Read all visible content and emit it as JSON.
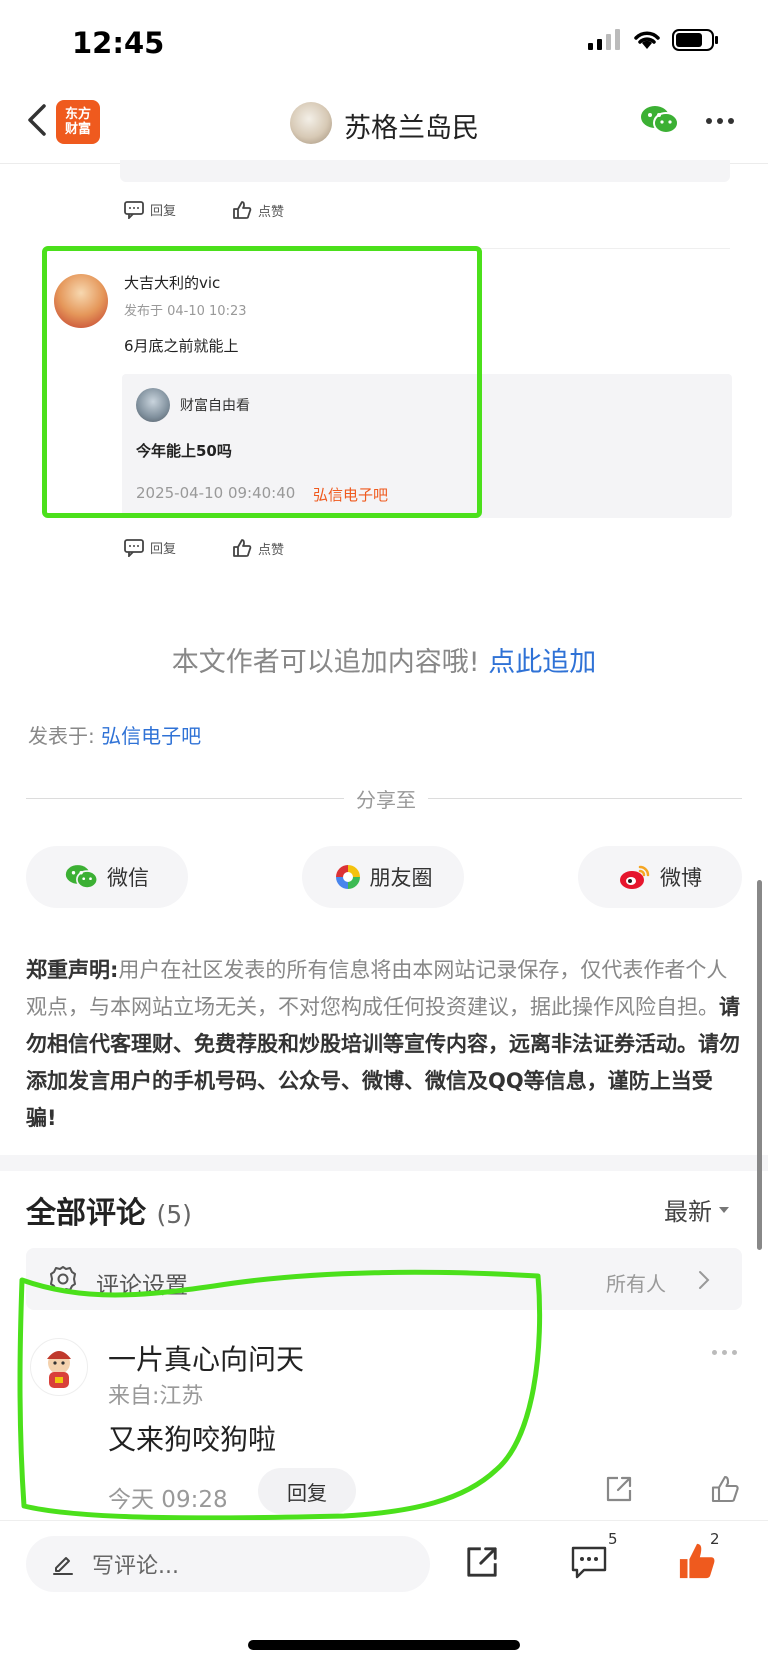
{
  "status_bar": {
    "time": "12:45"
  },
  "nav": {
    "logo_line1": "东方",
    "logo_line2": "财富",
    "title": "苏格兰岛民"
  },
  "top_actions": {
    "reply_label": "回复",
    "like_label": "点赞"
  },
  "reply": {
    "author": "大吉大利的vic",
    "posted_at": "发布于 04-10 10:23",
    "text": "6月底之前就能上",
    "quote": {
      "author": "财富自由看",
      "text": "今年能上50吗",
      "date": "2025-04-10 09:40:40",
      "bar": "弘信电子吧"
    },
    "reply_label": "回复",
    "like_label": "点赞"
  },
  "append": {
    "prompt": "本文作者可以追加内容哦!",
    "link": "点此追加"
  },
  "posted_in": {
    "label": "发表于:",
    "bar": "弘信电子吧"
  },
  "share": {
    "label": "分享至",
    "wechat": "微信",
    "moments": "朋友圈",
    "weibo": "微博"
  },
  "disclaimer": {
    "heading": "郑重声明:",
    "normal_text": "用户在社区发表的所有信息将由本网站记录保存，仅代表作者个人观点，与本网站立场无关，不对您构成任何投资建议，据此操作风险自担。",
    "bold_text": "请勿相信代客理财、免费荐股和炒股培训等宣传内容，远离非法证券活动。请勿添加发言用户的手机号码、公众号、微博、微信及QQ等信息，谨防上当受骗!"
  },
  "comments": {
    "title": "全部评论",
    "count": "(5)",
    "sort": "最新",
    "settings_label": "评论设置",
    "settings_value": "所有人",
    "items": [
      {
        "author": "一片真心向问天",
        "location": "来自:江苏",
        "text": "又来狗咬狗啦",
        "time": "今天 09:28",
        "reply_label": "回复"
      }
    ]
  },
  "bottom_bar": {
    "input_placeholder": "写评论...",
    "comment_count": "5",
    "like_count": "2"
  },
  "colors": {
    "brand_orange": "#ef5a1e",
    "link_blue": "#2f72d6",
    "highlight_green": "#4be01b",
    "wechat_green": "#3cb034"
  }
}
